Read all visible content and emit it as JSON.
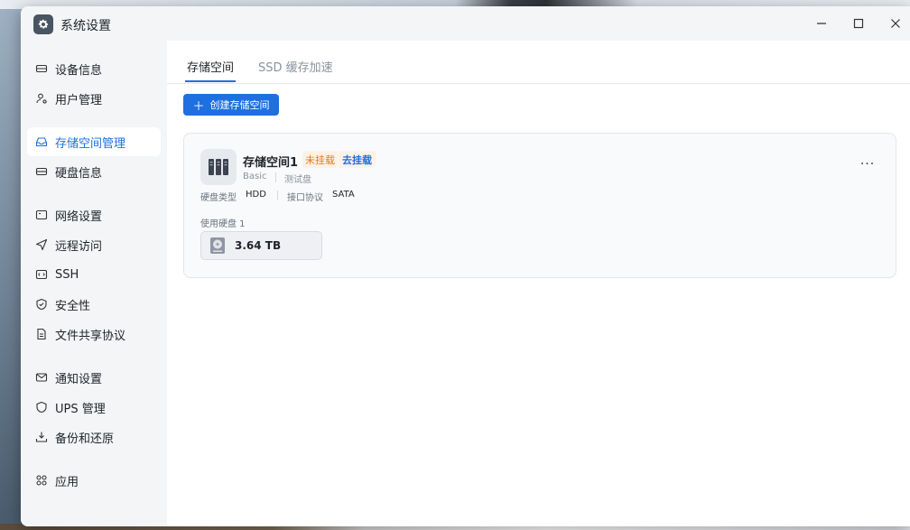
{
  "window": {
    "title": "系统设置",
    "icon": "gear-icon"
  },
  "window_controls": {
    "minimize_icon": "minimize-icon",
    "maximize_icon": "maximize-icon",
    "close_icon": "close-icon"
  },
  "sidebar": {
    "items": [
      {
        "label": "设备信息",
        "icon": "device-icon",
        "active": false
      },
      {
        "label": "用户管理",
        "icon": "user-icon",
        "active": false
      },
      {
        "label": "存储空间管理",
        "icon": "storage-icon",
        "active": true
      },
      {
        "label": "硬盘信息",
        "icon": "disk-icon",
        "active": false
      },
      {
        "label": "网络设置",
        "icon": "network-icon",
        "active": false
      },
      {
        "label": "远程访问",
        "icon": "send-icon",
        "active": false
      },
      {
        "label": "SSH",
        "icon": "terminal-icon",
        "active": false
      },
      {
        "label": "安全性",
        "icon": "shield-icon",
        "active": false
      },
      {
        "label": "文件共享协议",
        "icon": "file-icon",
        "active": false
      },
      {
        "label": "通知设置",
        "icon": "mail-icon",
        "active": false
      },
      {
        "label": "UPS 管理",
        "icon": "ups-icon",
        "active": false
      },
      {
        "label": "备份和还原",
        "icon": "backup-icon",
        "active": false
      },
      {
        "label": "应用",
        "icon": "apps-icon",
        "active": false
      }
    ]
  },
  "tabs": [
    {
      "label": "存储空间",
      "active": true
    },
    {
      "label": "SSD 缓存加速",
      "active": false
    }
  ],
  "toolbar": {
    "create_label": "创建存储空间"
  },
  "pool": {
    "name": "存储空间1",
    "status": "未挂载",
    "mount_action": "去挂载",
    "raid": "Basic",
    "description": "测试盘",
    "disk_type_label": "硬盘类型",
    "disk_type": "HDD",
    "interface_label": "接口协议",
    "interface": "SATA",
    "disks_label": "使用硬盘 1",
    "disk_size": "3.64 TB",
    "more_label": "···"
  },
  "colors": {
    "accent": "#1e6fe0",
    "warning": "#e07b1e",
    "sidebar_bg": "#f3f5f7"
  }
}
